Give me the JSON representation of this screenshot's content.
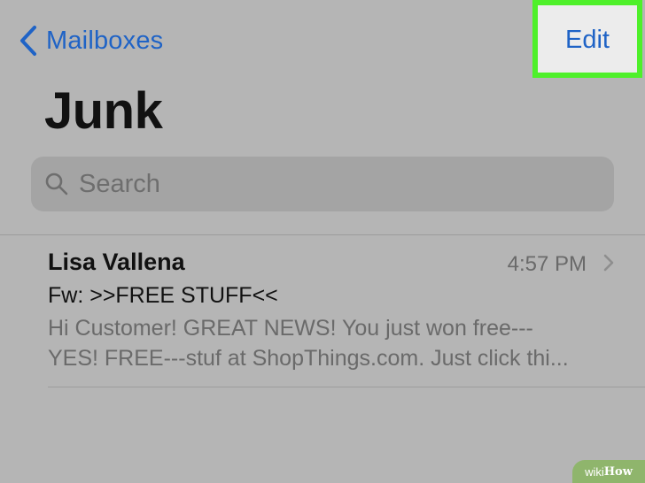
{
  "nav": {
    "back_label": "Mailboxes",
    "edit_label": "Edit",
    "highlight_color": "#4ef02a",
    "accent_color": "#1f63c6"
  },
  "page": {
    "title": "Junk"
  },
  "search": {
    "placeholder": "Search",
    "icon": "search-icon"
  },
  "messages": [
    {
      "sender": "Lisa Vallena",
      "time": "4:57 PM",
      "subject": "Fw: >>FREE STUFF<<",
      "preview_line_1": "Hi Customer! GREAT NEWS! You just won free---",
      "preview_line_2": "YES! FREE---stuf at ShopThings.com. Just click thi..."
    }
  ],
  "watermark": {
    "prefix": "wiki",
    "suffix": "How"
  }
}
